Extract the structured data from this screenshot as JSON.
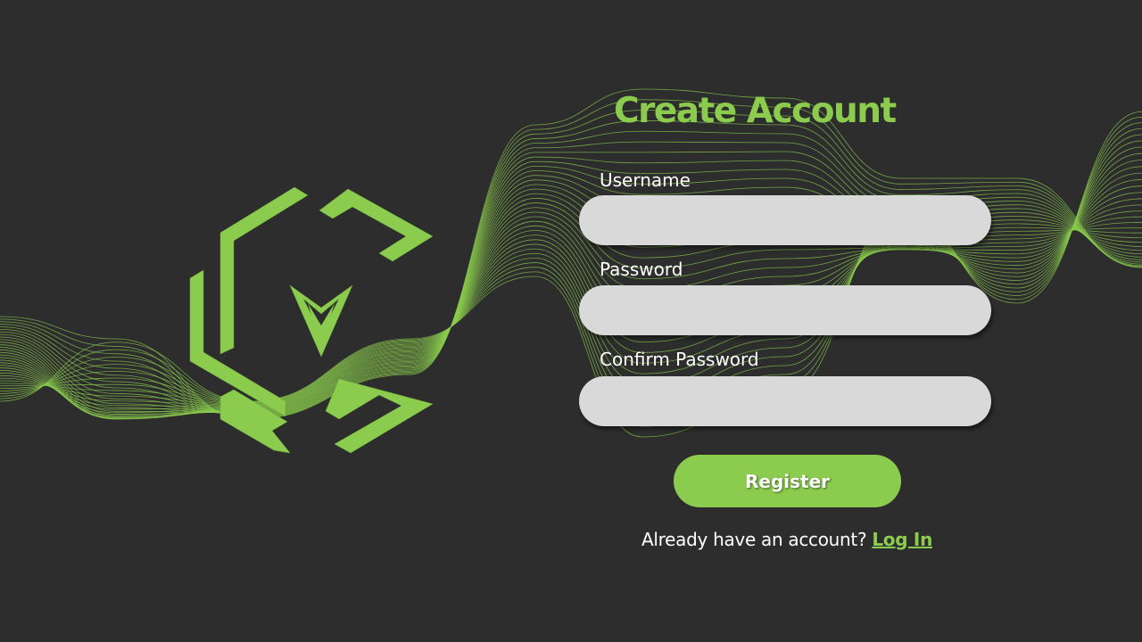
{
  "colors": {
    "background": "#2d2d2d",
    "accent": "#8bcc4e",
    "input_background": "#d9d9d9",
    "text": "#ffffff"
  },
  "logo": {
    "icon": "green-hexagon-chevron-logo-icon"
  },
  "form": {
    "title": "Create Account",
    "username": {
      "label": "Username",
      "value": "",
      "placeholder": ""
    },
    "password": {
      "label": "Password",
      "value": "",
      "placeholder": ""
    },
    "confirm_password": {
      "label": "Confirm Password",
      "value": "",
      "placeholder": ""
    },
    "register_label": "Register",
    "footer": {
      "prompt": "Already have an account?",
      "login_link": "Log In"
    }
  }
}
